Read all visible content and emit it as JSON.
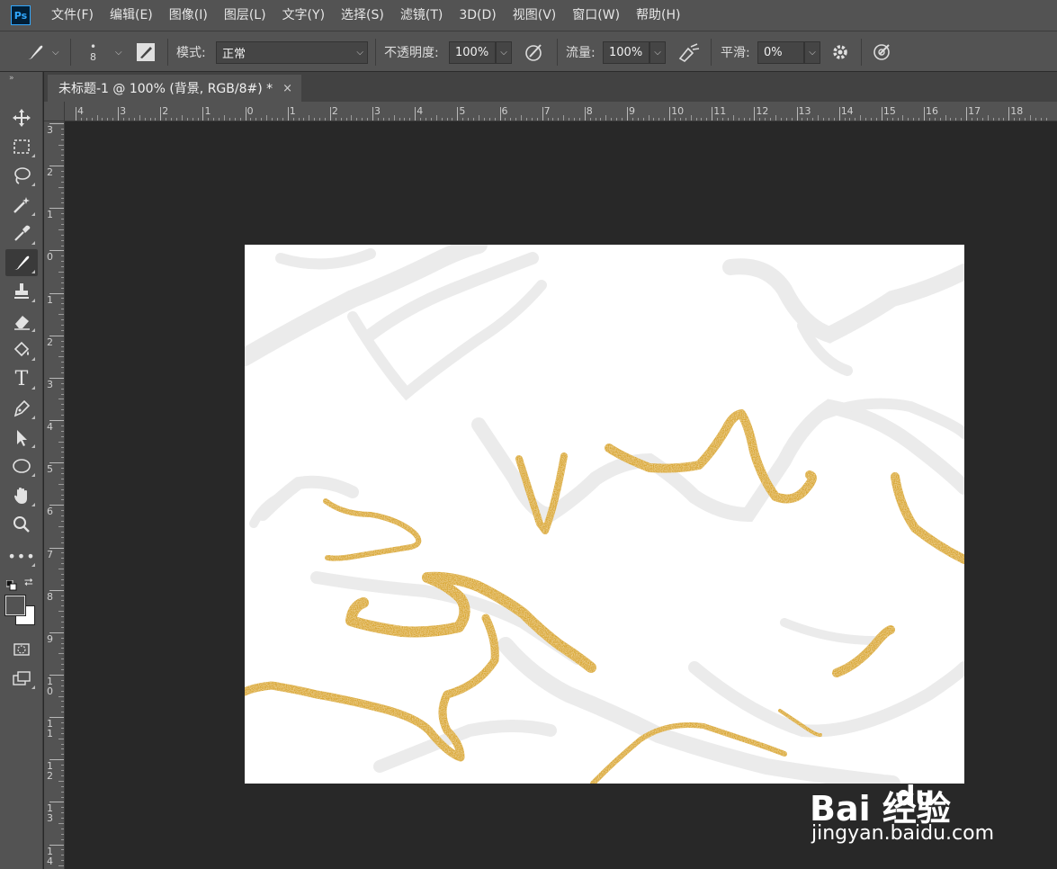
{
  "app": {
    "logo": "Ps"
  },
  "menu": [
    "文件(F)",
    "编辑(E)",
    "图像(I)",
    "图层(L)",
    "文字(Y)",
    "选择(S)",
    "滤镜(T)",
    "3D(D)",
    "视图(V)",
    "窗口(W)",
    "帮助(H)"
  ],
  "options": {
    "brush_size": "8",
    "mode_label": "模式:",
    "mode_value": "正常",
    "opacity_label": "不透明度:",
    "opacity_value": "100%",
    "flow_label": "流量:",
    "flow_value": "100%",
    "smoothing_label": "平滑:",
    "smoothing_value": "0%"
  },
  "document_tab": {
    "title": "未标题-1 @ 100% (背景, RGB/8#) *",
    "close": "×"
  },
  "ruler": {
    "horizontal": [
      "4",
      "3",
      "2",
      "1",
      "0",
      "1",
      "2",
      "3",
      "4",
      "5",
      "6",
      "7",
      "8",
      "9",
      "10",
      "11",
      "12",
      "13",
      "14",
      "15",
      "16",
      "17",
      "18"
    ],
    "vertical": [
      "3",
      "2",
      "1",
      "0",
      "1",
      "2",
      "3",
      "4",
      "5",
      "6",
      "7",
      "8",
      "9",
      "10",
      "11",
      "12",
      "13",
      "14"
    ]
  },
  "tools": [
    "move-icon",
    "marquee-icon",
    "lasso-icon",
    "magic-wand-icon",
    "eyedropper-icon",
    "brush-icon",
    "stamp-icon",
    "eraser-icon",
    "paint-bucket-icon",
    "type-icon",
    "pen-icon",
    "path-select-icon",
    "ellipse-icon",
    "hand-icon",
    "zoom-icon",
    "more-icon"
  ],
  "colors": {
    "foreground": "#535353",
    "background": "#ffffff",
    "gold": "#d9a730"
  },
  "watermark": {
    "brand": "Bai  经验",
    "brand_du": "du",
    "url": "jingyan.baidu.com"
  }
}
